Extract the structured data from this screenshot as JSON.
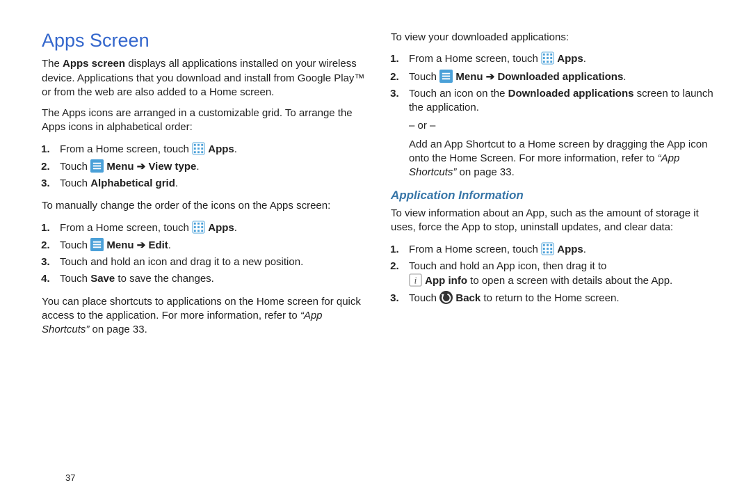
{
  "left": {
    "h1": "Apps Screen",
    "p1a": "The ",
    "p1_bold": "Apps screen",
    "p1b": " displays all applications installed on your wireless device. Applications that you download and install from Google Play™ or from the web are also added to a Home screen.",
    "p2": "The Apps icons are arranged in a customizable grid. To arrange the Apps icons in alphabetical order:",
    "l1": {
      "1_pre": "From a Home screen, touch ",
      "1_post": "Apps",
      "2_pre": "Touch ",
      "2_mid": " Menu ➔ View type",
      "3_pre": "Touch ",
      "3_bold": "Alphabetical grid"
    },
    "p3": "To manually change the order of the icons on the Apps screen:",
    "l2": {
      "1_pre": "From a Home screen, touch ",
      "1_post": "Apps",
      "2_pre": "Touch ",
      "2_mid": " Menu ➔ Edit",
      "3": "Touch and hold an icon and drag it to a new position.",
      "4_pre": "Touch ",
      "4_bold": "Save",
      "4_post": " to save the changes."
    },
    "p4a": "You can place shortcuts to applications on the Home screen for quick access to the application. For more information, refer to ",
    "p4_ref": "“App Shortcuts”",
    "p4b": "  on page 33."
  },
  "right": {
    "p1": "To view your downloaded applications:",
    "l1": {
      "1_pre": "From a Home screen, touch ",
      "1_post": "Apps",
      "2_pre": "Touch ",
      "2_mid": " Menu ➔ Downloaded applications",
      "3_pre": "Touch an icon on the ",
      "3_bold": "Downloaded applications",
      "3_post": " screen to launch the application.",
      "or": "– or –",
      "or_p_a": "Add an App Shortcut to a Home screen by dragging the App icon onto the Home Screen. For more information, refer to ",
      "or_ref": "“App Shortcuts”",
      "or_p_b": "  on page 33."
    },
    "h2": "Application Information",
    "p2": "To view information about an App, such as the amount of storage it uses, force the App to stop, uninstall updates, and clear data:",
    "l2": {
      "1_pre": "From a Home screen, touch ",
      "1_post": "Apps",
      "2": "Touch and hold an App icon, then drag it to",
      "2b_bold": " App info",
      "2b_post": " to open a screen with details about the App.",
      "3_pre": "Touch  ",
      "3_bold": "Back",
      "3_post": " to return to the Home screen."
    }
  },
  "page_number": "37"
}
